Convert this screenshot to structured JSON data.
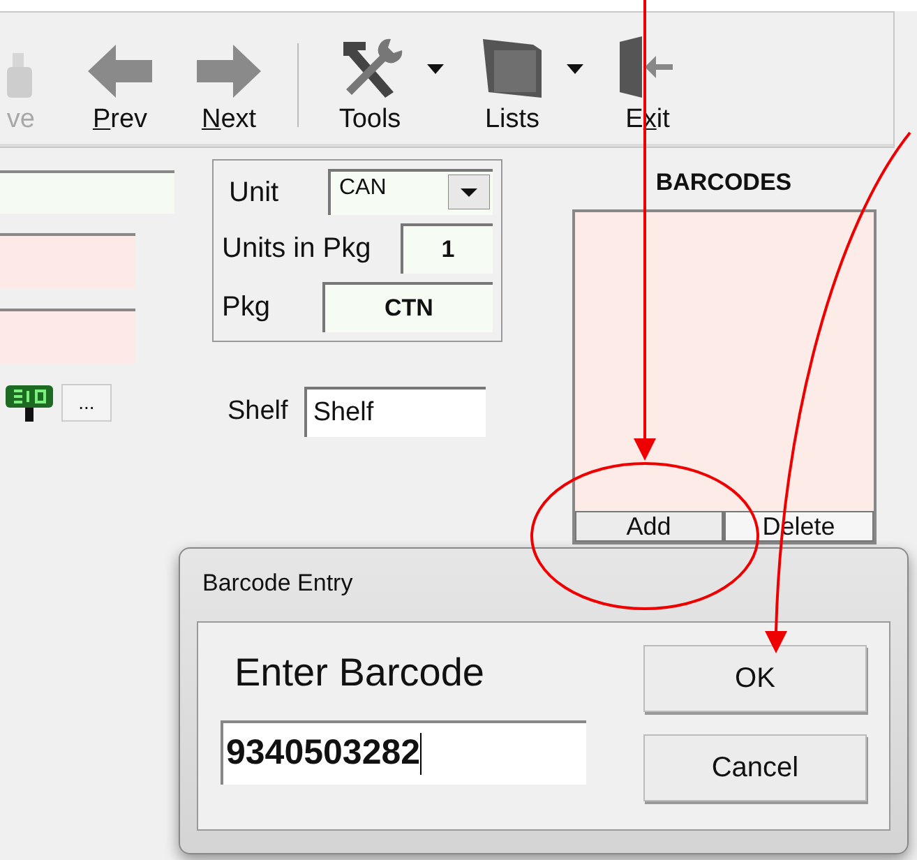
{
  "toolbar": {
    "buttons": [
      {
        "kind": "save",
        "label": "ve",
        "disabled": true,
        "dropdown": false
      },
      {
        "kind": "prev",
        "mnemonic": "P",
        "label_after": "rev",
        "disabled": false,
        "dropdown": false
      },
      {
        "kind": "next",
        "mnemonic": "N",
        "label_after": "ext",
        "disabled": false,
        "dropdown": false
      },
      {
        "kind": "tools",
        "label": "Tools",
        "disabled": false,
        "dropdown": true
      },
      {
        "kind": "lists",
        "label": "Lists",
        "disabled": false,
        "dropdown": true
      },
      {
        "kind": "exit",
        "label_before": "E",
        "mnemonic": "x",
        "label_after": "it",
        "disabled": false,
        "dropdown": false
      }
    ]
  },
  "left_fields": [
    {
      "color": "#f5fbf3"
    },
    {
      "color": "#fde9e7"
    },
    {
      "color": "#fde9e7"
    }
  ],
  "more_button": {
    "label": "..."
  },
  "unit_group": {
    "unit": {
      "label": "Unit",
      "value": "CAN"
    },
    "units_in_pkg": {
      "label": "Units in Pkg",
      "value": "1"
    },
    "pkg": {
      "label": "Pkg",
      "value": "CTN"
    }
  },
  "shelf": {
    "label": "Shelf",
    "value": "Shelf"
  },
  "barcodes": {
    "title": "BARCODES",
    "buttons": [
      "Add",
      "Delete"
    ]
  },
  "dialog": {
    "title": "Barcode Entry",
    "prompt": "Enter Barcode",
    "value": "9340503282",
    "buttons": [
      "OK",
      "Cancel"
    ]
  }
}
